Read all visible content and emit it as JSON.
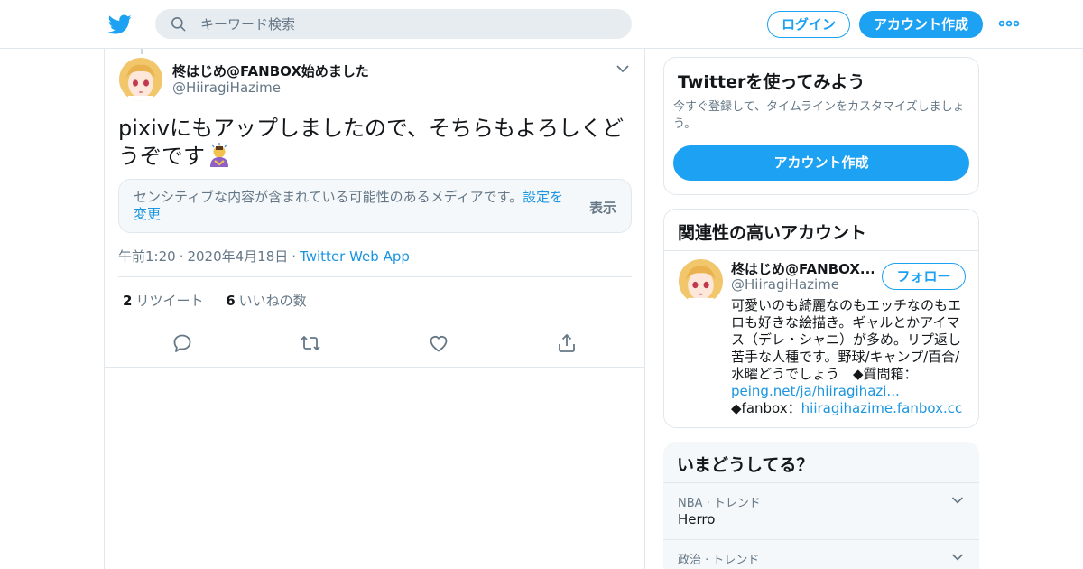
{
  "header": {
    "search_placeholder": "キーワード検索",
    "login_label": "ログイン",
    "signup_label": "アカウント作成"
  },
  "tweet": {
    "author_name": "柊はじめ@FANBOX始めました",
    "author_handle": "@HiiragiHazime",
    "text": "pixivにもアップしましたので、そちらもよろしくどうぞです",
    "emoji": "person-bowing-emoji",
    "sensitive_message": "センシティブな内容が含まれている可能性のあるメディアです。",
    "sensitive_settings_link": "設定を変更",
    "sensitive_show_label": "表示",
    "time": "午前1:20",
    "date": "2020年4月18日",
    "source": "Twitter Web App",
    "retweet_count": "2",
    "retweet_label": "リツイート",
    "like_count": "6",
    "like_label": "いいねの数"
  },
  "sidebar": {
    "signup_card": {
      "title": "Twitterを使ってみよう",
      "subtitle": "今すぐ登録して、タイムラインをカスタマイズしましょう。",
      "button_label": "アカウント作成"
    },
    "related": {
      "title": "関連性の高いアカウント",
      "account_name": "柊はじめ@FANBOX...",
      "account_handle": "@HiiragiHazime",
      "follow_label": "フォロー",
      "bio_text": "可愛いのも綺麗なのもエッチなのもエロも好きな絵描き。ギャルとかアイマス（デレ・シャニ）が多め。リプ返し苦手な人種です。野球/キャンプ/百合/水曜どうでしょう　◆質問箱：",
      "bio_link1": "peing.net/ja/hiiragihazi...",
      "bio_fanbox_label": "◆fanbox：",
      "bio_link2": "hiiragihazime.fanbox.cc"
    },
    "trends": {
      "title": "いまどうしてる？",
      "items": [
        {
          "context": "NBA · トレンド",
          "name": "Herro"
        },
        {
          "context": "政治 · トレンド",
          "name": ""
        }
      ]
    }
  },
  "colors": {
    "brand_blue": "#1da1f2",
    "link_blue": "#1b95e0",
    "secondary_text": "#657786",
    "border": "#e1e8ed"
  }
}
